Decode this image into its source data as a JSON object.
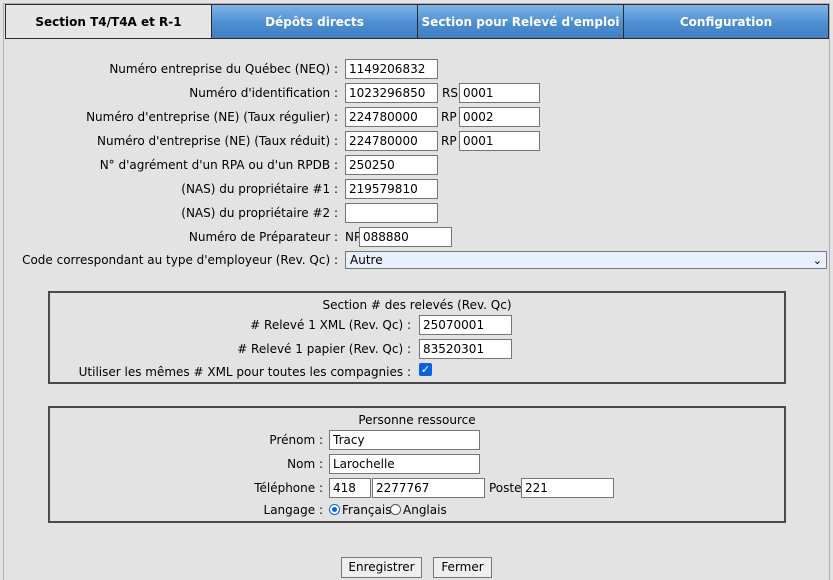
{
  "tabs": [
    {
      "label": "Section T4/T4A et R-1",
      "active": true
    },
    {
      "label": "Dépôts directs",
      "active": false
    },
    {
      "label": "Section pour Relevé d'emploi",
      "active": false
    },
    {
      "label": "Configuration",
      "active": false
    }
  ],
  "form": {
    "neq": {
      "label": "Numéro entreprise du Québec (NEQ) :",
      "value": "1149206832"
    },
    "id": {
      "label": "Numéro d'identification :",
      "value": "1023296850",
      "suffix_label": "RS",
      "suffix_value": "0001"
    },
    "ne_regular": {
      "label": "Numéro d'entreprise (NE) (Taux régulier) :",
      "value": "224780000",
      "suffix_label": "RP",
      "suffix_value": "0002"
    },
    "ne_reduced": {
      "label": "Numéro d'entreprise (NE) (Taux réduit) :",
      "value": "224780000",
      "suffix_label": "RP",
      "suffix_value": "0001"
    },
    "rpa": {
      "label": "N° d'agrément d'un RPA ou d'un RPDB :",
      "value": "250250"
    },
    "nas1": {
      "label": "(NAS) du propriétaire #1 :",
      "value": "219579810"
    },
    "nas2": {
      "label": "(NAS) du propriétaire #2 :",
      "value": ""
    },
    "preparer": {
      "label": "Numéro de Préparateur :",
      "prefix": "NP",
      "value": "088880"
    },
    "employer_type": {
      "label": "Code correspondant au type d'employeur (Rev. Qc) :",
      "value": "Autre"
    }
  },
  "releves": {
    "title": "Section # des relevés (Rev. Qc)",
    "xml_label": "# Relevé 1 XML (Rev. Qc) :",
    "xml_value": "25070001",
    "paper_label": "# Relevé 1 papier (Rev. Qc) :",
    "paper_value": "83520301",
    "same_label": "Utiliser les mêmes # XML pour toutes les compagnies :",
    "same_checked": true
  },
  "contact": {
    "title": "Personne ressource",
    "first_label": "Prénom :",
    "first_value": "Tracy",
    "last_label": "Nom :",
    "last_value": "Larochelle",
    "phone_label": "Téléphone :",
    "area": "418",
    "number": "2277767",
    "ext_label": "Poste",
    "ext_value": "221",
    "lang_label": "Langage :",
    "lang_fr": "Français",
    "lang_en": "Anglais",
    "lang_selected": "Français"
  },
  "buttons": {
    "save": "Enregistrer",
    "close": "Fermer"
  }
}
